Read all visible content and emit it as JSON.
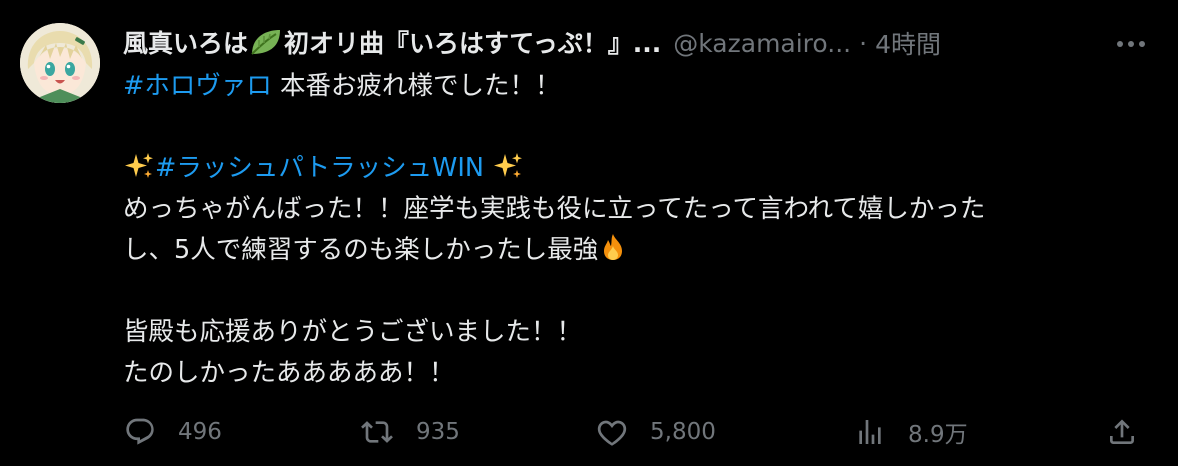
{
  "author": {
    "display_name_part1": "風真いろは",
    "display_name_part2": "初オリ曲『いろはすてっぷ！』...",
    "handle": "@kazamairo...",
    "separator": "·",
    "time": "4時間"
  },
  "body": {
    "line1_hashtag": "#ホロヴァロ",
    "line1_text": " 本番お疲れ様でした！！",
    "line2_hashtag": "#ラッシュパトラッシュWIN",
    "line3": "めっちゃがんばった！！座学も実践も役に立ってたって言われて嬉しかった",
    "line4": "し、5人で練習するのも楽しかったし最強",
    "line5": "皆殿も応援ありがとうございました！！",
    "line6": "たのしかったあああああ！！"
  },
  "actions": {
    "reply_count": "496",
    "retweet_count": "935",
    "like_count": "5,800",
    "views_count": "8.9万"
  },
  "icons": {
    "leaf": "leaf-emoji",
    "sparkles": "sparkles-emoji",
    "fire": "fire-emoji",
    "more": "more-horizontal-icon",
    "reply": "reply-icon",
    "retweet": "retweet-icon",
    "like": "heart-icon",
    "views": "views-bar-chart-icon",
    "share": "share-icon"
  },
  "colors": {
    "background": "#000000",
    "text": "#e7e9ea",
    "secondary": "#71767b",
    "link": "#1d9bf0"
  }
}
